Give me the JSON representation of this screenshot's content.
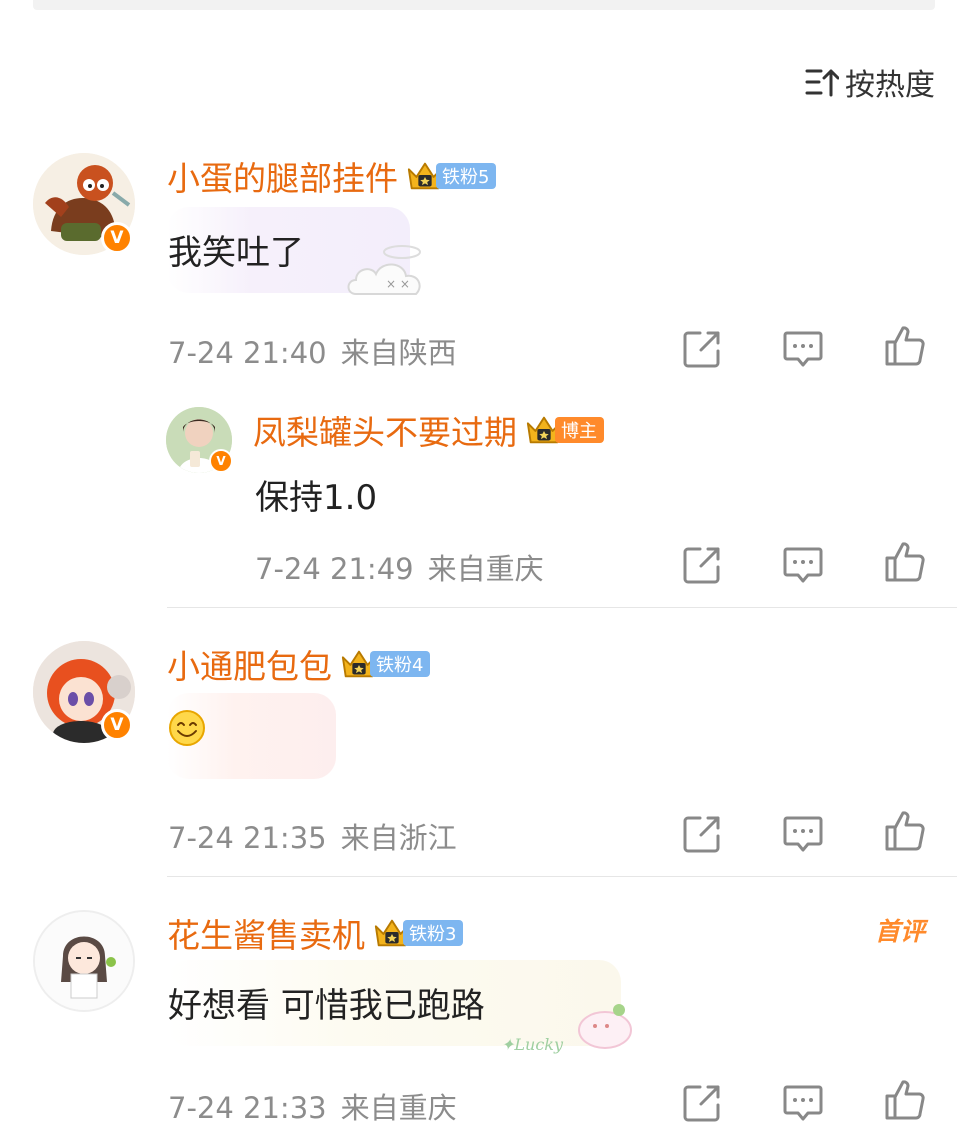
{
  "sort": {
    "label": "按热度",
    "icon": "sort-icon"
  },
  "comments": [
    {
      "username": "小蛋的腿部挂件",
      "fan_badge": "铁粉5",
      "text": "我笑吐了",
      "time": "7-24 21:40",
      "location": "来自陕西",
      "verified": "V",
      "reply": {
        "username": "凤梨罐头不要过期",
        "role_badge": "博主",
        "text": "保持1.0",
        "time": "7-24 21:49",
        "location": "来自重庆",
        "verified": "V"
      }
    },
    {
      "username": "小通肥包包",
      "fan_badge": "铁粉4",
      "text": "",
      "emoji": "smile-emoji",
      "time": "7-24 21:35",
      "location": "来自浙江",
      "verified": "V"
    },
    {
      "username": "花生酱售卖机",
      "fan_badge": "铁粉3",
      "first_comment_label": "首评",
      "text": "好想看 可惜我已跑路",
      "time": "7-24 21:33",
      "location": "来自重庆"
    }
  ],
  "colors": {
    "username": "#e86a10",
    "meta": "#8c8c8c",
    "fan_badge": "#7db6f0",
    "blogger_badge": "#ff8a2b"
  }
}
